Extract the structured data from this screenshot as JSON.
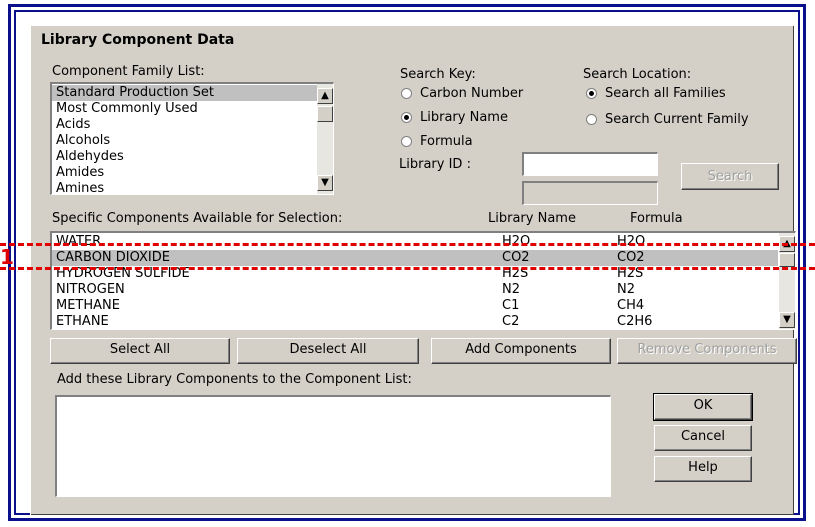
{
  "dialog": {
    "title": "Library Component Data"
  },
  "family": {
    "label": "Component Family List:",
    "items": [
      "Standard Production Set",
      "Most Commonly Used",
      "Acids",
      "Alcohols",
      "Aldehydes",
      "Amides",
      "Amines"
    ],
    "selected_index": 0
  },
  "search_key": {
    "label": "Search Key:",
    "options": [
      "Carbon Number",
      "Library Name",
      "Formula"
    ],
    "selected": "Library Name"
  },
  "search_location": {
    "label": "Search Location:",
    "options": [
      "Search all Families",
      "Search Current Family"
    ],
    "selected": "Search all Families"
  },
  "library_id": {
    "label": "Library ID :",
    "value": ""
  },
  "search_button": "Search",
  "components": {
    "label": "Specific Components Available for Selection:",
    "col_library_name": "Library Name",
    "col_formula": "Formula",
    "rows": [
      {
        "name": "WATER",
        "library": "H2O",
        "formula": "H2O"
      },
      {
        "name": "CARBON DIOXIDE",
        "library": "CO2",
        "formula": "CO2"
      },
      {
        "name": "HYDROGEN SULFIDE",
        "library": "H2S",
        "formula": "H2S"
      },
      {
        "name": "NITROGEN",
        "library": "N2",
        "formula": "N2"
      },
      {
        "name": "METHANE",
        "library": "C1",
        "formula": "CH4"
      },
      {
        "name": "ETHANE",
        "library": "C2",
        "formula": "C2H6"
      }
    ],
    "selected_index": 1
  },
  "buttons": {
    "select_all": "Select All",
    "deselect_all": "Deselect All",
    "add_components": "Add Components",
    "remove_components": "Remove Components",
    "ok": "OK",
    "cancel": "Cancel",
    "help": "Help"
  },
  "add_list_label": "Add these Library Components to the Component List:",
  "annotation": {
    "text": "1",
    "color": "#e00000"
  },
  "colors": {
    "frame": "#0a0f8c",
    "dialog_bg": "#d4d0c8",
    "selection": "#c0c0c0"
  }
}
